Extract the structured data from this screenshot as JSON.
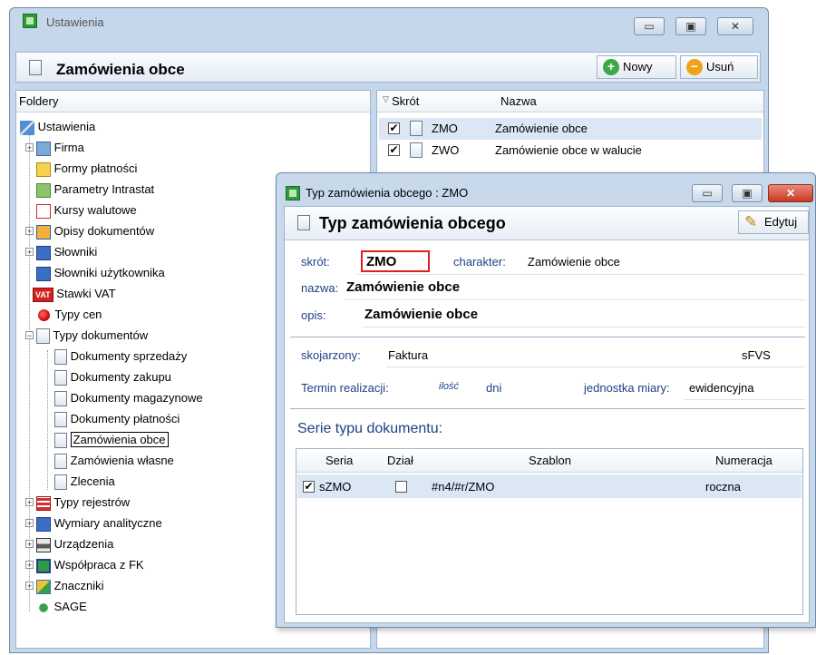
{
  "main_window": {
    "title": "Ustawienia",
    "header_title": "Zamówienia obce",
    "buttons": {
      "new": "Nowy",
      "delete": "Usuń"
    },
    "window_controls": {
      "minimize": "▭",
      "maximize": "▣",
      "close": "✕"
    }
  },
  "folders": {
    "header": "Foldery",
    "items": [
      {
        "label": "Ustawienia"
      },
      {
        "label": "Firma"
      },
      {
        "label": "Formy płatności"
      },
      {
        "label": "Parametry Intrastat"
      },
      {
        "label": "Kursy walutowe"
      },
      {
        "label": "Opisy dokumentów"
      },
      {
        "label": "Słowniki"
      },
      {
        "label": "Słowniki użytkownika"
      },
      {
        "label": "Stawki VAT"
      },
      {
        "label": "Typy cen"
      },
      {
        "label": "Typy dokumentów"
      },
      {
        "label": "Dokumenty sprzedaży"
      },
      {
        "label": "Dokumenty zakupu"
      },
      {
        "label": "Dokumenty magazynowe"
      },
      {
        "label": "Dokumenty płatności"
      },
      {
        "label": "Zamówienia obce"
      },
      {
        "label": "Zamówienia własne"
      },
      {
        "label": "Zlecenia"
      },
      {
        "label": "Typy rejestrów"
      },
      {
        "label": "Wymiary analityczne"
      },
      {
        "label": "Urządzenia"
      },
      {
        "label": "Współpraca z FK"
      },
      {
        "label": "Znaczniki"
      },
      {
        "label": "SAGE"
      }
    ],
    "vat_badge": "VAT"
  },
  "list": {
    "columns": {
      "shortcut": "Skrót",
      "name": "Nazwa"
    },
    "rows": [
      {
        "code": "ZMO",
        "name": "Zamówienie obce"
      },
      {
        "code": "ZWO",
        "name": "Zamówienie obce w walucie"
      }
    ]
  },
  "dialog": {
    "title": "Typ zamówienia obcego : ZMO",
    "header_title": "Typ zamówienia obcego",
    "edit_button": "Edytuj",
    "fields": {
      "skrot_label": "skrót:",
      "skrot_value": "ZMO",
      "charakter_label": "charakter:",
      "charakter_value": "Zamówienie obce",
      "nazwa_label": "nazwa:",
      "nazwa_value": "Zamówienie obce",
      "opis_label": "opis:",
      "opis_value": "Zamówienie obce",
      "skojarzony_label": "skojarzony:",
      "skojarzony_value": "Faktura",
      "skojarzony_code": "sFVS",
      "termin_label": "Termin realizacji:",
      "termin_value": "ilość",
      "termin_unit": "dni",
      "jednostka_label": "jednostka miary:",
      "jednostka_value": "ewidencyjna"
    },
    "series": {
      "section_title": "Serie typu dokumentu:",
      "columns": {
        "seria": "Seria",
        "dzial": "Dział",
        "szablon": "Szablon",
        "numeracja": "Numeracja"
      },
      "rows": [
        {
          "seria": "sZMO",
          "szablon": "#n4/#r/ZMO",
          "numeracja": "roczna"
        }
      ]
    }
  },
  "colors": {
    "selection": "#dbe7f5",
    "accent": "#1f3f87",
    "highlight_box": "#e02020"
  }
}
